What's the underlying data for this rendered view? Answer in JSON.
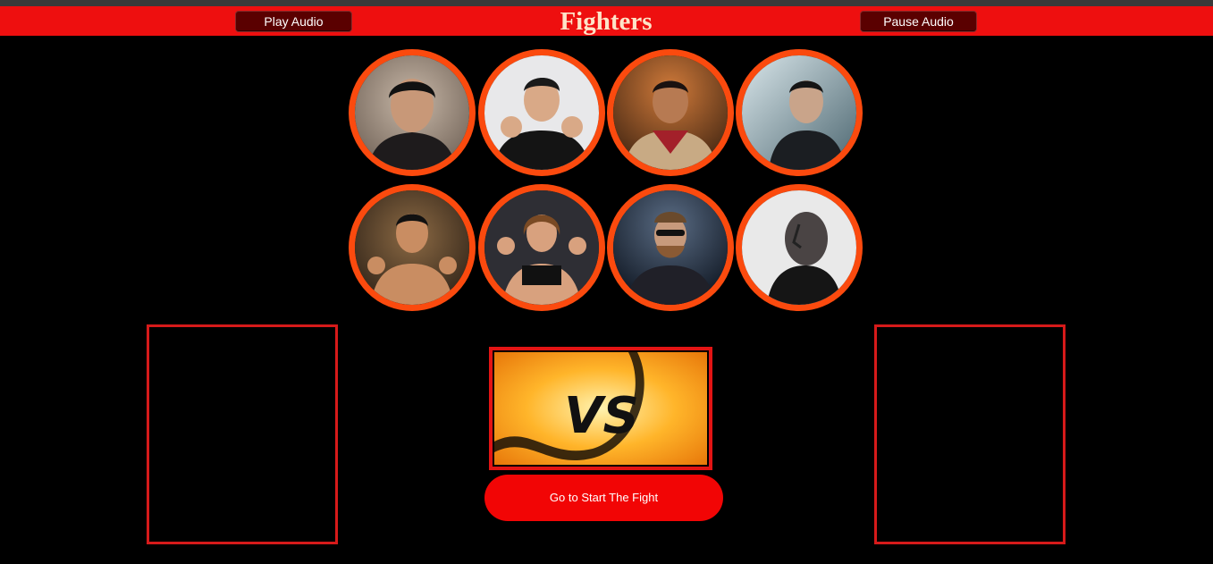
{
  "header": {
    "title": "Fighters",
    "play_audio_label": "Play Audio",
    "pause_audio_label": "Pause Audio",
    "background_color": "#ee0f0f",
    "title_color": "#fde4c8"
  },
  "fighters": [
    {
      "icon": "fighter-portrait-1"
    },
    {
      "icon": "fighter-portrait-2"
    },
    {
      "icon": "fighter-portrait-3"
    },
    {
      "icon": "fighter-portrait-4"
    },
    {
      "icon": "fighter-portrait-5"
    },
    {
      "icon": "fighter-portrait-6"
    },
    {
      "icon": "fighter-portrait-7"
    },
    {
      "icon": "fighter-portrait-8"
    }
  ],
  "fighter_ring_color": "#fb4a0e",
  "vs_banner": {
    "text": "VS"
  },
  "start_button": {
    "label": "Go to Start The Fight",
    "color": "#f20505"
  },
  "slot_border_color": "#d61a1a"
}
